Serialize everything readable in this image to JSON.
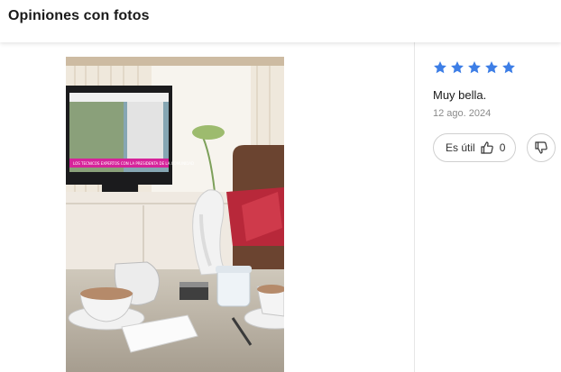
{
  "header": {
    "title": "Opiniones con fotos"
  },
  "photo": {
    "tv_banner_text": "LOS TECNICOS EXPERTOS CON LA PRESIDENTA DE LA COMUNIDAD"
  },
  "review": {
    "rating": 5,
    "rating_max": 5,
    "star_color": "#3d7ee6",
    "text": "Muy bella.",
    "date": "12 ago. 2024",
    "helpful_label": "Es útil",
    "helpful_count": "0",
    "helpful_icon": "thumbs-up-icon",
    "unhelpful_icon": "thumbs-down-icon"
  }
}
